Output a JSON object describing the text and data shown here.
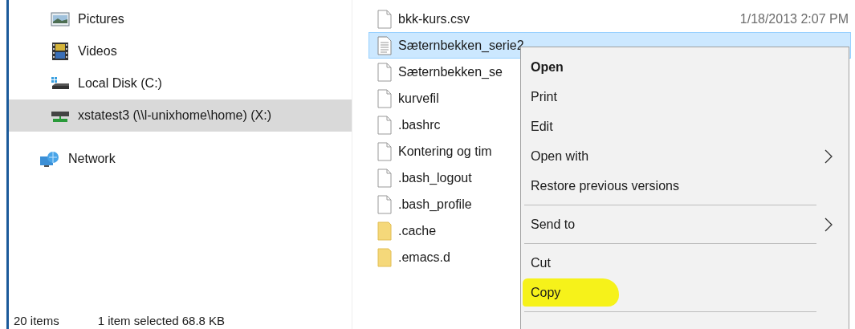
{
  "navigation": {
    "items": [
      {
        "label": "Pictures",
        "selected": false
      },
      {
        "label": "Videos",
        "selected": false
      },
      {
        "label": "Local Disk (C:)",
        "selected": false
      },
      {
        "label": "xstatest3 (\\\\l-unixhome\\home) (X:)",
        "selected": true
      },
      {
        "label": "Network",
        "selected": false
      }
    ]
  },
  "files": [
    {
      "name": "bkk-kurs.csv",
      "kind": "file",
      "date": "1/18/2013 2:07 PM",
      "selected": false
    },
    {
      "name": "Sæternbekken_serie2",
      "kind": "text",
      "selected": true
    },
    {
      "name": "Sæternbekken_se",
      "kind": "file",
      "selected": false
    },
    {
      "name": "kurvefil",
      "kind": "file",
      "selected": false
    },
    {
      "name": ".bashrc",
      "kind": "file",
      "selected": false
    },
    {
      "name": "Kontering og tim",
      "kind": "file",
      "selected": false
    },
    {
      "name": ".bash_logout",
      "kind": "file",
      "selected": false
    },
    {
      "name": ".bash_profile",
      "kind": "file",
      "selected": false
    },
    {
      "name": ".cache",
      "kind": "folder",
      "selected": false
    },
    {
      "name": ".emacs.d",
      "kind": "folder",
      "selected": false
    }
  ],
  "context_menu": {
    "items": [
      {
        "kind": "item",
        "label": "Open",
        "default": true,
        "submenu": false,
        "highlighted": false
      },
      {
        "kind": "item",
        "label": "Print",
        "default": false,
        "submenu": false,
        "highlighted": false
      },
      {
        "kind": "item",
        "label": "Edit",
        "default": false,
        "submenu": false,
        "highlighted": false
      },
      {
        "kind": "item",
        "label": "Open with",
        "default": false,
        "submenu": true,
        "highlighted": false
      },
      {
        "kind": "item",
        "label": "Restore previous versions",
        "default": false,
        "submenu": false,
        "highlighted": false
      },
      {
        "kind": "separator"
      },
      {
        "kind": "item",
        "label": "Send to",
        "default": false,
        "submenu": true,
        "highlighted": false
      },
      {
        "kind": "separator"
      },
      {
        "kind": "item",
        "label": "Cut",
        "default": false,
        "submenu": false,
        "highlighted": false
      },
      {
        "kind": "item",
        "label": "Copy",
        "default": false,
        "submenu": false,
        "highlighted": true
      },
      {
        "kind": "separator"
      }
    ]
  },
  "status_bar": {
    "item_count": "20 items",
    "selection": "1 item selected  68.8 KB"
  }
}
